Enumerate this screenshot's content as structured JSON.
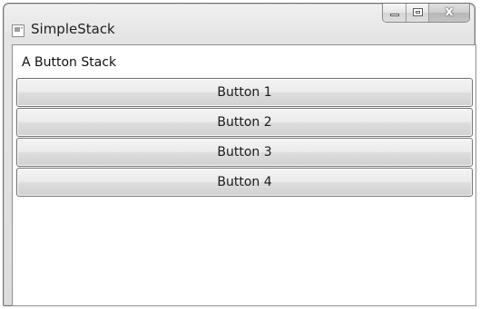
{
  "window": {
    "title": "SimpleStack",
    "icon": "app-window-icon",
    "caption_buttons": [
      {
        "name": "minimize",
        "icon": "minimize-icon"
      },
      {
        "name": "maximize",
        "icon": "maximize-icon"
      },
      {
        "name": "close",
        "icon": "close-icon",
        "glyph": "x"
      }
    ]
  },
  "content": {
    "label": "A Button Stack",
    "buttons": [
      {
        "label": "Button 1"
      },
      {
        "label": "Button 2"
      },
      {
        "label": "Button 3"
      },
      {
        "label": "Button 4"
      }
    ]
  },
  "colors": {
    "frame": "#e4e4e4",
    "client_background": "#ffffff",
    "button_border": "#707070"
  }
}
